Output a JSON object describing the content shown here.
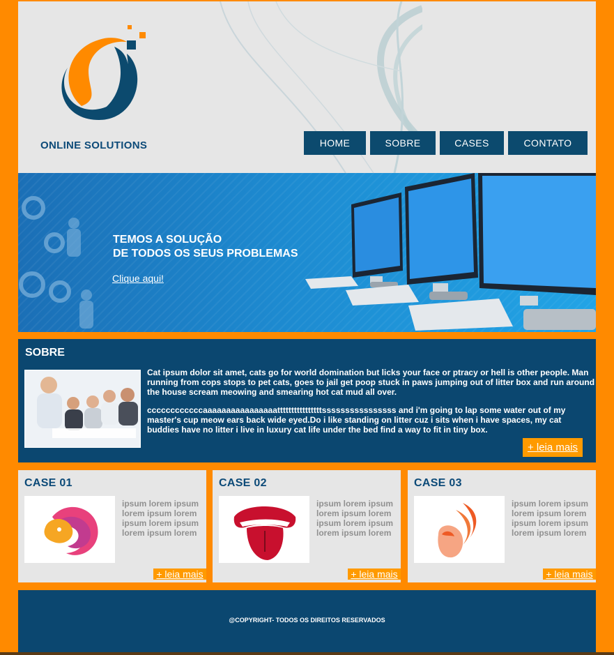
{
  "header": {
    "brand": "ONLINE SOLUTIONS",
    "nav": [
      "HOME",
      "SOBRE",
      "CASES",
      "CONTATO"
    ]
  },
  "banner": {
    "line1": "TEMOS A SOLUÇÃO",
    "line2": "DE TODOS OS SEUS PROBLEMAS",
    "link": "Clique aqui!"
  },
  "sobre": {
    "title": "SOBRE",
    "p1": "Cat ipsum dolor sit amet, cats go for world domination but licks your face or ptracy or hell is other people. Man running from cops stops to pet cats, goes to jail get poop stuck in paws jumping out of litter box and run around the house scream meowing and smearing hot cat mud all over.",
    "p2": "ccccccccccccaaaaaaaaaaaaaaaattttttttttttttttssssssssssssssss and i'm going to lap some water out of my master's cup meow ears back wide eyed.Do i like standing on litter cuz i sits when i have spaces, my cat buddies have no litter i live in luxury cat life under the bed find a way to fit in tiny box.",
    "more": "+ leia mais"
  },
  "cases": [
    {
      "title": "CASE 01",
      "text": "ipsum lorem ipsum lorem ipsum lorem ipsum lorem ipsum lorem ipsum lorem",
      "more": "+ leia mais",
      "icon": "lion-logo-icon"
    },
    {
      "title": "CASE 02",
      "text": "ipsum lorem ipsum lorem ipsum lorem ipsum lorem ipsum lorem ipsum lorem",
      "more": "+ leia mais",
      "icon": "tongue-logo-icon"
    },
    {
      "title": "CASE 03",
      "text": "ipsum lorem ipsum lorem ipsum lorem ipsum lorem ipsum lorem ipsum lorem",
      "more": "+ leia mais",
      "icon": "bird-logo-icon"
    }
  ],
  "footer": {
    "text": "@COPYRIGHT- TODOS OS DIREITOS RESERVADOS"
  },
  "colors": {
    "frame": "#ff8a00",
    "navy": "#0b4770",
    "accent": "#ff9a00",
    "panel": "#e6e6e6"
  }
}
